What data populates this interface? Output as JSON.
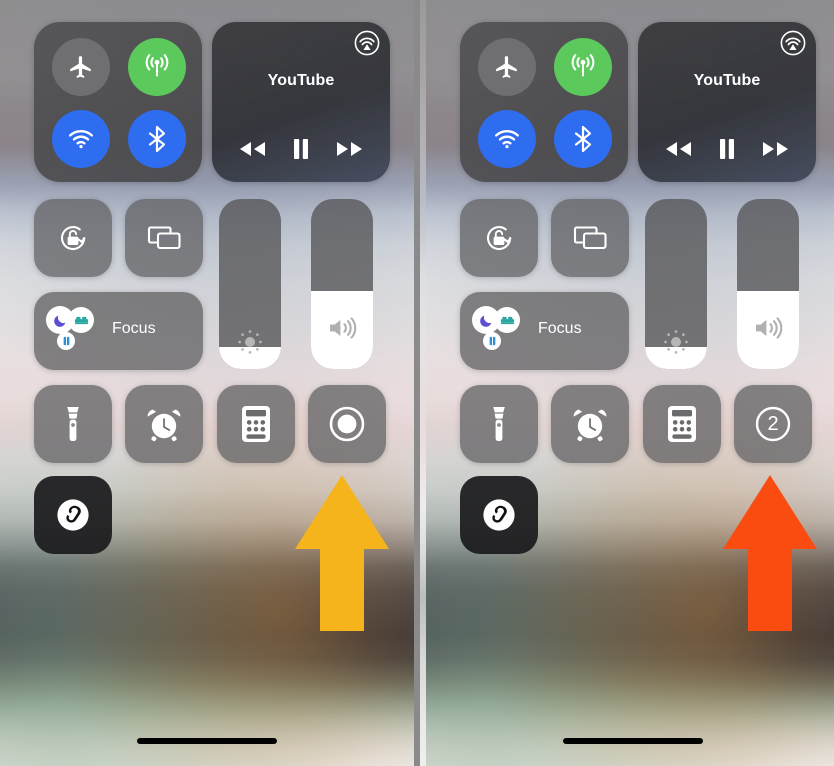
{
  "screenshot": {
    "description": "iOS Control Center comparison, two phone screens side by side",
    "panel_count": 2
  },
  "colors": {
    "tile_bg": "#5a5a5c",
    "toggle_off": "#6f6f71",
    "cellular_on": "#5cc95c",
    "wifi_on": "#2f6df0",
    "bluetooth_on": "#2f6df0",
    "arrow_left": "#F5B31C",
    "arrow_right": "#FA4B10",
    "slider_fill": "#ffffff",
    "shazam_tile": "#1a1a1c"
  },
  "panels": [
    {
      "id": "left",
      "connectivity": {
        "airplane": {
          "label": "Airplane Mode",
          "icon": "airplane-icon",
          "state": "off"
        },
        "cellular": {
          "label": "Cellular Data",
          "icon": "cellular-icon",
          "state": "on"
        },
        "wifi": {
          "label": "Wi-Fi",
          "icon": "wifi-icon",
          "state": "on"
        },
        "bluetooth": {
          "label": "Bluetooth",
          "icon": "bluetooth-icon",
          "state": "on"
        }
      },
      "media": {
        "title": "YouTube",
        "airplay_icon": "airplay-icon",
        "rewind_icon": "rewind-icon",
        "playpause_icon": "pause-icon",
        "forward_icon": "fast-forward-icon"
      },
      "rotation_lock": {
        "label": "Rotation Lock",
        "icon": "rotation-lock-icon",
        "state": "off"
      },
      "screen_mirroring": {
        "label": "Screen Mirroring",
        "icon": "screen-mirroring-icon"
      },
      "focus": {
        "label": "Focus",
        "icons": [
          "moon-icon",
          "bed-icon",
          "book-icon"
        ]
      },
      "brightness": {
        "label": "Brightness",
        "icon": "brightness-icon",
        "value": 13
      },
      "volume": {
        "label": "Volume",
        "icon": "speaker-icon",
        "value": 46
      },
      "apps": [
        {
          "label": "Flashlight",
          "icon": "flashlight-icon"
        },
        {
          "label": "Timer",
          "icon": "alarm-clock-icon"
        },
        {
          "label": "Calculator",
          "icon": "calculator-icon"
        },
        {
          "label": "Screen Recording",
          "icon": "record-icon",
          "countdown": ""
        }
      ],
      "shazam": {
        "label": "Shazam",
        "icon": "shazam-icon"
      },
      "arrow": {
        "name": "highlight-arrow-yellow",
        "color": "#F5B31C",
        "points_to": "Screen Recording"
      }
    },
    {
      "id": "right",
      "connectivity": {
        "airplane": {
          "label": "Airplane Mode",
          "icon": "airplane-icon",
          "state": "off"
        },
        "cellular": {
          "label": "Cellular Data",
          "icon": "cellular-icon",
          "state": "on"
        },
        "wifi": {
          "label": "Wi-Fi",
          "icon": "wifi-icon",
          "state": "on"
        },
        "bluetooth": {
          "label": "Bluetooth",
          "icon": "bluetooth-icon",
          "state": "on"
        }
      },
      "media": {
        "title": "YouTube",
        "airplay_icon": "airplay-icon",
        "rewind_icon": "rewind-icon",
        "playpause_icon": "pause-icon",
        "forward_icon": "fast-forward-icon"
      },
      "rotation_lock": {
        "label": "Rotation Lock",
        "icon": "rotation-lock-icon",
        "state": "off"
      },
      "screen_mirroring": {
        "label": "Screen Mirroring",
        "icon": "screen-mirroring-icon"
      },
      "focus": {
        "label": "Focus",
        "icons": [
          "moon-icon",
          "bed-icon",
          "book-icon"
        ]
      },
      "brightness": {
        "label": "Brightness",
        "icon": "brightness-icon",
        "value": 13
      },
      "volume": {
        "label": "Volume",
        "icon": "speaker-icon",
        "value": 46
      },
      "apps": [
        {
          "label": "Flashlight",
          "icon": "flashlight-icon"
        },
        {
          "label": "Timer",
          "icon": "alarm-clock-icon"
        },
        {
          "label": "Calculator",
          "icon": "calculator-icon"
        },
        {
          "label": "Screen Recording",
          "icon": "countdown",
          "countdown": "2"
        }
      ],
      "shazam": {
        "label": "Shazam",
        "icon": "shazam-icon"
      },
      "arrow": {
        "name": "highlight-arrow-orange",
        "color": "#FA4B10",
        "points_to": "Screen Recording countdown"
      }
    }
  ]
}
